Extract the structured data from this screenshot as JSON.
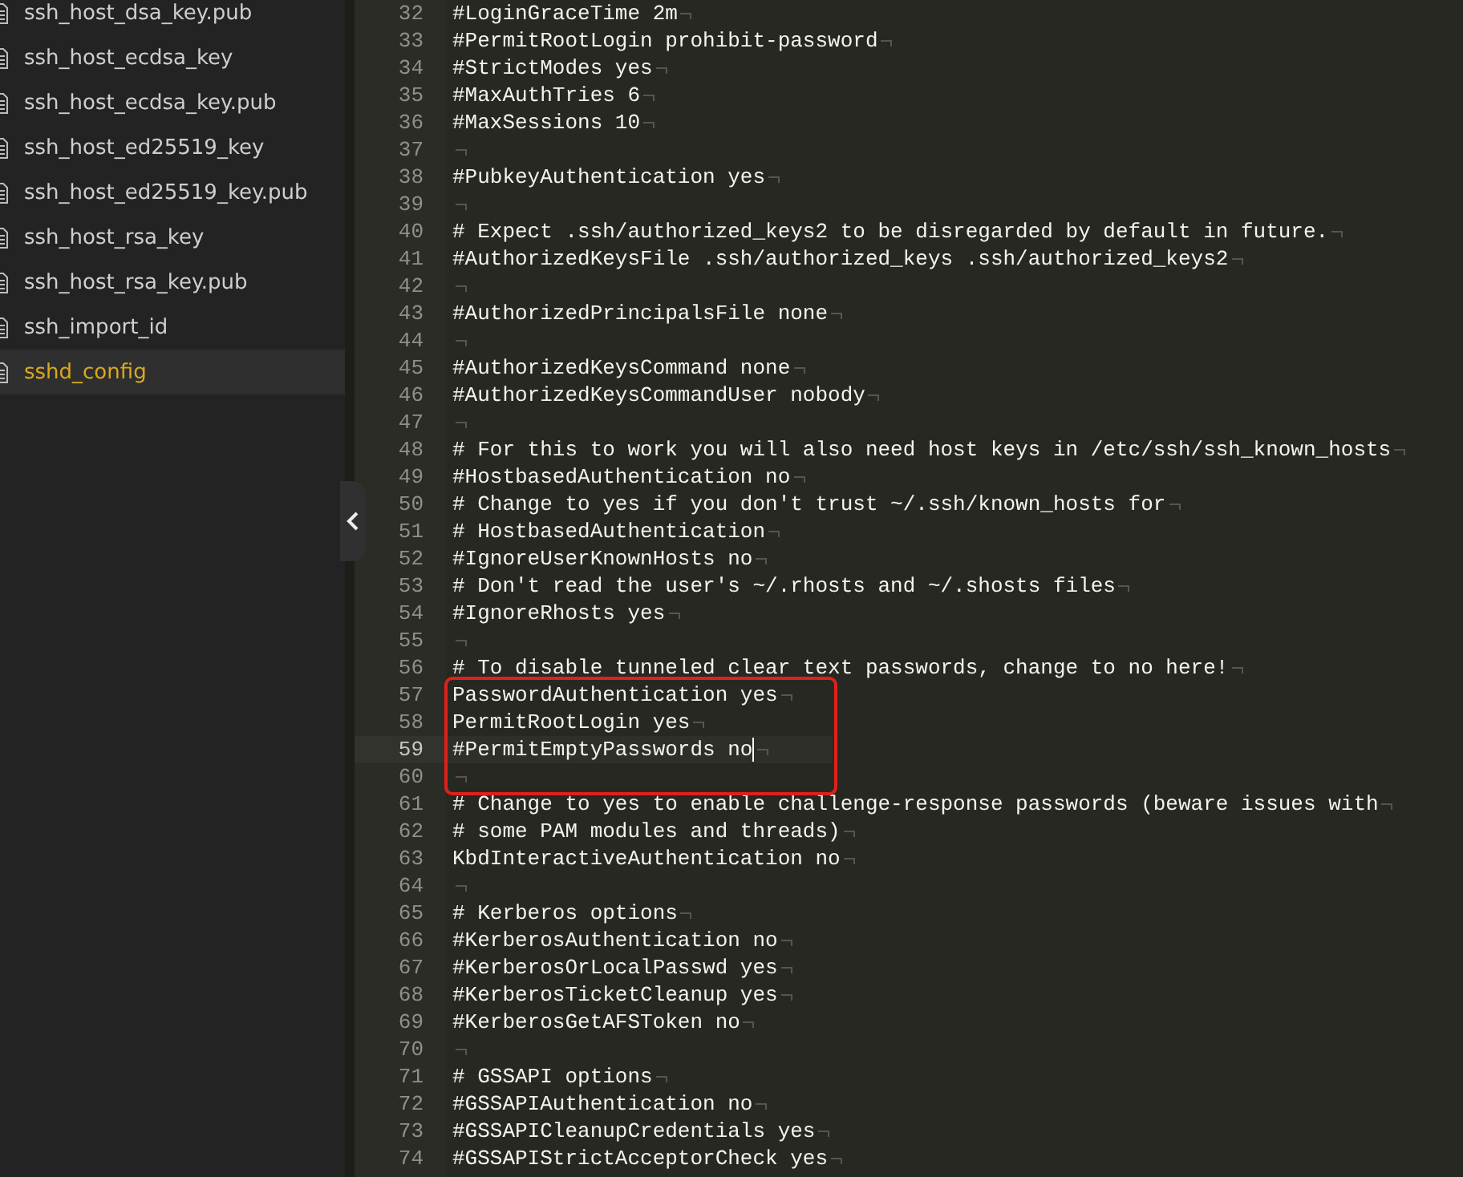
{
  "sidebar": {
    "items": [
      {
        "name": "ssh_host_dsa_key.pub",
        "selected": false
      },
      {
        "name": "ssh_host_ecdsa_key",
        "selected": false
      },
      {
        "name": "ssh_host_ecdsa_key.pub",
        "selected": false
      },
      {
        "name": "ssh_host_ed25519_key",
        "selected": false
      },
      {
        "name": "ssh_host_ed25519_key.pub",
        "selected": false
      },
      {
        "name": "ssh_host_rsa_key",
        "selected": false
      },
      {
        "name": "ssh_host_rsa_key.pub",
        "selected": false
      },
      {
        "name": "ssh_import_id",
        "selected": false
      },
      {
        "name": "sshd_config",
        "selected": true
      }
    ]
  },
  "editor": {
    "lines": [
      {
        "number": "32",
        "text": "#LoginGraceTime 2m",
        "current": false,
        "boxed": false
      },
      {
        "number": "33",
        "text": "#PermitRootLogin prohibit-password",
        "current": false,
        "boxed": false
      },
      {
        "number": "34",
        "text": "#StrictModes yes",
        "current": false,
        "boxed": false
      },
      {
        "number": "35",
        "text": "#MaxAuthTries 6",
        "current": false,
        "boxed": false
      },
      {
        "number": "36",
        "text": "#MaxSessions 10",
        "current": false,
        "boxed": false
      },
      {
        "number": "37",
        "current": false,
        "boxed": false
      },
      {
        "number": "38",
        "text": "#PubkeyAuthentication yes",
        "current": false,
        "boxed": false
      },
      {
        "number": "39",
        "current": false,
        "boxed": false
      },
      {
        "number": "40",
        "text": "# Expect .ssh/authorized_keys2 to be disregarded by default in future.",
        "current": false,
        "boxed": false
      },
      {
        "number": "41",
        "text": "#AuthorizedKeysFile .ssh/authorized_keys .ssh/authorized_keys2",
        "current": false,
        "boxed": false
      },
      {
        "number": "42",
        "current": false,
        "boxed": false
      },
      {
        "number": "43",
        "text": "#AuthorizedPrincipalsFile none",
        "current": false,
        "boxed": false
      },
      {
        "number": "44",
        "current": false,
        "boxed": false
      },
      {
        "number": "45",
        "text": "#AuthorizedKeysCommand none",
        "current": false,
        "boxed": false
      },
      {
        "number": "46",
        "text": "#AuthorizedKeysCommandUser nobody",
        "current": false,
        "boxed": false
      },
      {
        "number": "47",
        "current": false,
        "boxed": false
      },
      {
        "number": "48",
        "text": "# For this to work you will also need host keys in /etc/ssh/ssh_known_hosts",
        "current": false,
        "boxed": false
      },
      {
        "number": "49",
        "text": "#HostbasedAuthentication no",
        "current": false,
        "boxed": false
      },
      {
        "number": "50",
        "text": "# Change to yes if you don't trust ~/.ssh/known_hosts for",
        "current": false,
        "boxed": false
      },
      {
        "number": "51",
        "text": "# HostbasedAuthentication",
        "current": false,
        "boxed": false
      },
      {
        "number": "52",
        "text": "#IgnoreUserKnownHosts no",
        "current": false,
        "boxed": false
      },
      {
        "number": "53",
        "text": "# Don't read the user's ~/.rhosts and ~/.shosts files",
        "current": false,
        "boxed": false
      },
      {
        "number": "54",
        "text": "#IgnoreRhosts yes",
        "current": false,
        "boxed": false
      },
      {
        "number": "55",
        "current": false,
        "boxed": false
      },
      {
        "number": "56",
        "text": "# To disable tunneled clear text passwords, change to no here!",
        "current": false,
        "boxed": false
      },
      {
        "number": "57",
        "text": "PasswordAuthentication yes",
        "current": false,
        "boxed": true
      },
      {
        "number": "58",
        "text": "PermitRootLogin yes",
        "current": false,
        "boxed": true
      },
      {
        "number": "59",
        "text": "#PermitEmptyPasswords no",
        "current": true,
        "boxed": true
      },
      {
        "number": "60",
        "current": false,
        "boxed": true
      },
      {
        "number": "61",
        "text": "# Change to yes to enable challenge-response passwords (beware issues with",
        "current": false,
        "boxed": false
      },
      {
        "number": "62",
        "text": "# some PAM modules and threads)",
        "current": false,
        "boxed": false
      },
      {
        "number": "63",
        "text": "KbdInteractiveAuthentication no",
        "current": false,
        "boxed": false
      },
      {
        "number": "64",
        "current": false,
        "boxed": false
      },
      {
        "number": "65",
        "text": "# Kerberos options",
        "current": false,
        "boxed": false
      },
      {
        "number": "66",
        "text": "#KerberosAuthentication no",
        "current": false,
        "boxed": false
      },
      {
        "number": "67",
        "text": "#KerberosOrLocalPasswd yes",
        "current": false,
        "boxed": false
      },
      {
        "number": "68",
        "text": "#KerberosTicketCleanup yes",
        "current": false,
        "boxed": false
      },
      {
        "number": "69",
        "text": "#KerberosGetAFSToken no",
        "current": false,
        "boxed": false
      },
      {
        "number": "70",
        "current": false,
        "boxed": false
      },
      {
        "number": "71",
        "text": "# GSSAPI options",
        "current": false,
        "boxed": false
      },
      {
        "number": "72",
        "text": "#GSSAPIAuthentication no",
        "current": false,
        "boxed": false
      },
      {
        "number": "73",
        "text": "#GSSAPICleanupCredentials yes",
        "current": false,
        "boxed": false
      },
      {
        "number": "74",
        "text": "#GSSAPIStrictAcceptorCheck yes",
        "current": false,
        "boxed": false
      }
    ]
  }
}
